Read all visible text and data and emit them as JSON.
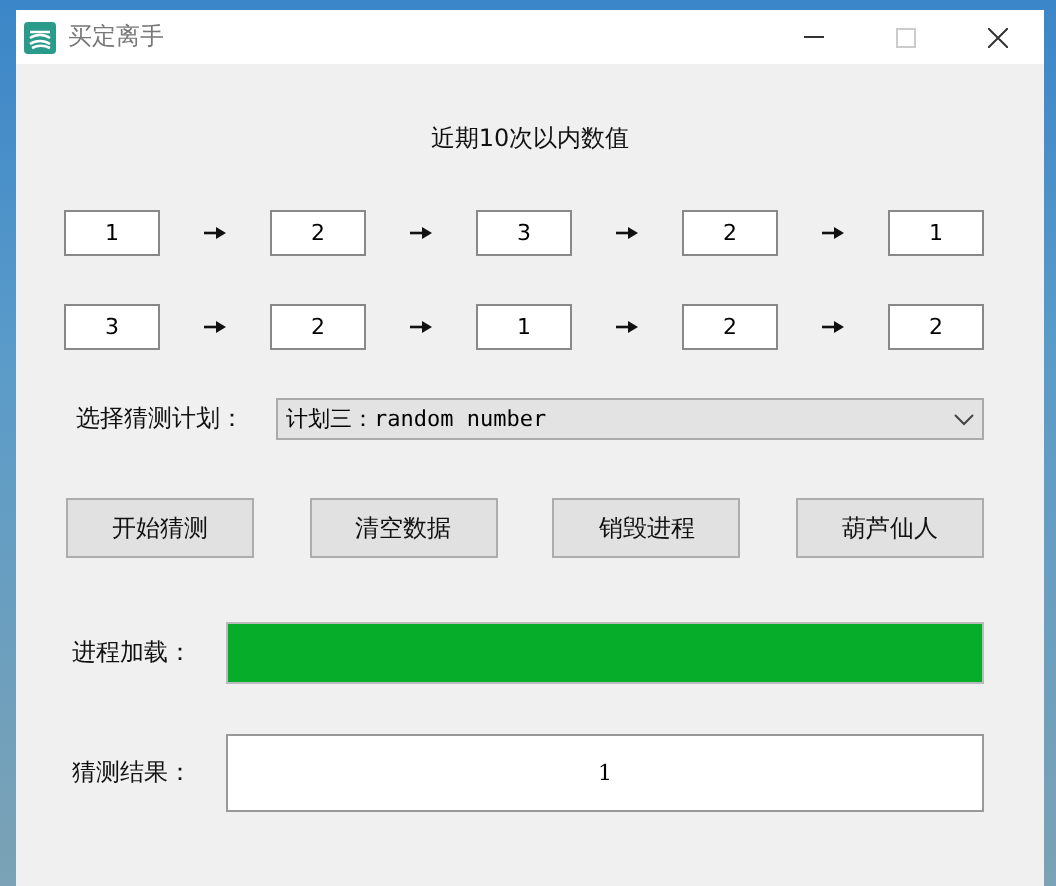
{
  "window": {
    "title": "买定离手"
  },
  "heading": "近期10次以内数值",
  "history_rows": [
    [
      "1",
      "2",
      "3",
      "2",
      "1"
    ],
    [
      "3",
      "2",
      "1",
      "2",
      "2"
    ]
  ],
  "plan": {
    "label": "选择猜测计划：",
    "value": "计划三：random number"
  },
  "buttons": [
    "开始猜测",
    "清空数据",
    "销毁进程",
    "葫芦仙人"
  ],
  "progress": {
    "label": "进程加载：",
    "level": 1
  },
  "result": {
    "label": "猜测结果：",
    "value": "1"
  }
}
